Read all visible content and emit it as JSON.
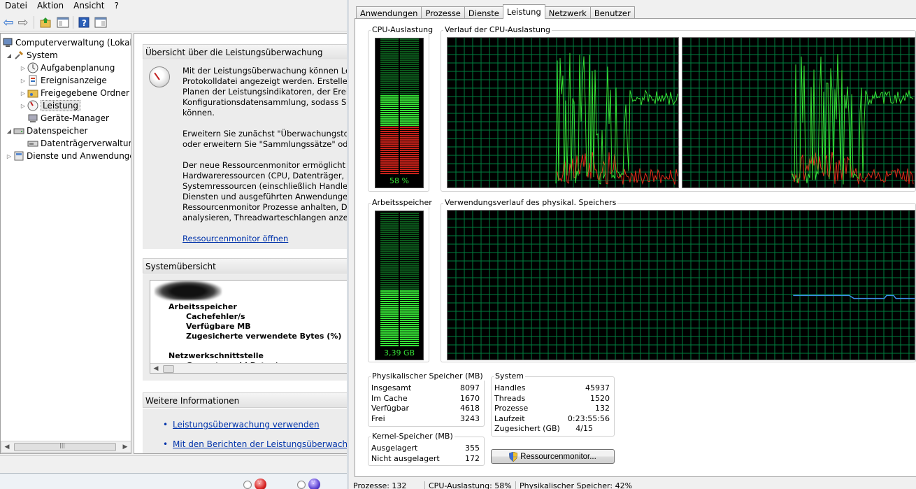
{
  "mmc": {
    "menu": [
      "Datei",
      "Aktion",
      "Ansicht",
      "?"
    ],
    "tree": [
      {
        "label": "Computerverwaltung (Lokal)",
        "depth": 0,
        "icon": "computer-icon",
        "expander": ""
      },
      {
        "label": "System",
        "depth": 1,
        "icon": "tools-icon",
        "expander": "◢"
      },
      {
        "label": "Aufgabenplanung",
        "depth": 2,
        "icon": "clock-icon",
        "expander": "▷"
      },
      {
        "label": "Ereignisanzeige",
        "depth": 2,
        "icon": "event-viewer-icon",
        "expander": "▷"
      },
      {
        "label": "Freigegebene Ordner",
        "depth": 2,
        "icon": "shared-folder-icon",
        "expander": "▷"
      },
      {
        "label": "Leistung",
        "depth": 2,
        "icon": "performance-icon",
        "expander": "▷",
        "selected": true
      },
      {
        "label": "Geräte-Manager",
        "depth": 2,
        "icon": "device-manager-icon",
        "expander": ""
      },
      {
        "label": "Datenspeicher",
        "depth": 1,
        "icon": "storage-icon",
        "expander": "◢"
      },
      {
        "label": "Datenträgerverwaltung",
        "depth": 2,
        "icon": "disk-icon",
        "expander": ""
      },
      {
        "label": "Dienste und Anwendungen",
        "depth": 1,
        "icon": "services-icon",
        "expander": "▷"
      }
    ],
    "overview": {
      "title": "Übersicht über die Leistungsüberwachung",
      "paragraphs": [
        [
          "Mit der Leistungsüberwachung können Leist",
          "Protokolldatei angezeigt werden. Erstellen Si",
          "Planen der Leistungsindikatoren, der Ereignis",
          "Konfigurationsdatensammlung, sodass Sie d",
          "können."
        ],
        [
          "Erweitern Sie zunächst \"Überwachungstools",
          "oder erweitern Sie \"Sammlungssätze\" oder \""
        ],
        [
          "Der neue Ressourcenmonitor ermöglicht die",
          "Hardwareressourcen (CPU, Datenträger, Netz",
          "Systemressourcen (einschließlich Handles u",
          "Diensten und ausgeführten Anwendungen v",
          "Ressourcenmonitor Prozesse anhalten, Dienst",
          "analysieren, Threadwarteschlangen anzeigen"
        ]
      ],
      "link": "Ressourcenmonitor öffnen"
    },
    "system_overview": {
      "title": "Systemübersicht",
      "lines": [
        {
          "text": "Arbeitsspeicher",
          "indent": 1
        },
        {
          "text": "Cachefehler/s",
          "indent": 2
        },
        {
          "text": "Verfügbare MB",
          "indent": 2
        },
        {
          "text": "Zugesicherte verwendete Bytes (%)",
          "indent": 2
        },
        {
          "text": "",
          "indent": 2
        },
        {
          "text": "Netzwerkschnittstelle",
          "indent": 1
        },
        {
          "text": "Gesamtanzahl Bytes/s",
          "indent": 2
        }
      ]
    },
    "more_info": {
      "title": "Weitere Informationen",
      "links": [
        "Leistungsüberwachung verwenden",
        "Mit den Berichten der Leistungsüberwachung a"
      ]
    }
  },
  "taskmgr": {
    "tabs": [
      "Anwendungen",
      "Prozesse",
      "Dienste",
      "Leistung",
      "Netzwerk",
      "Benutzer"
    ],
    "active_tab": "Leistung",
    "cpu_usage_label": "CPU-Auslastung",
    "cpu_usage_value": "58 %",
    "cpu_usage_fraction": 0.58,
    "cpu_history_label": "Verlauf der CPU-Auslastung",
    "memory_label": "Arbeitsspeicher",
    "memory_value": "3,39 GB",
    "memory_fraction": 0.42,
    "memory_history_label": "Verwendungsverlauf des physikal. Speichers",
    "physical_memory": {
      "title": "Physikalischer Speicher (MB)",
      "rows": [
        {
          "label": "Insgesamt",
          "value": "8097"
        },
        {
          "label": "Im Cache",
          "value": "1670"
        },
        {
          "label": "Verfügbar",
          "value": "4618"
        },
        {
          "label": "Frei",
          "value": "3243"
        }
      ]
    },
    "kernel_memory": {
      "title": "Kernel-Speicher (MB)",
      "rows": [
        {
          "label": "Ausgelagert",
          "value": "355"
        },
        {
          "label": "Nicht ausgelagert",
          "value": "172"
        }
      ]
    },
    "system": {
      "title": "System",
      "rows": [
        {
          "label": "Handles",
          "value": "45937"
        },
        {
          "label": "Threads",
          "value": "1520"
        },
        {
          "label": "Prozesse",
          "value": "132"
        },
        {
          "label": "Laufzeit",
          "value": "0:23:55:56"
        },
        {
          "label": "Zugesichert (GB)",
          "value": "4/15"
        }
      ]
    },
    "resource_monitor_button": "Ressourcenmonitor...",
    "status": [
      "Prozesse: 132",
      "CPU-Auslastung: 58%",
      "Physikalischer Speicher: 42%"
    ]
  },
  "colors": {
    "graph_green": "#36e236",
    "graph_red": "#e02a1a",
    "grid_green": "#007f3f",
    "memory_line": "#3c8ee8",
    "meter_red": "#c8221a"
  }
}
